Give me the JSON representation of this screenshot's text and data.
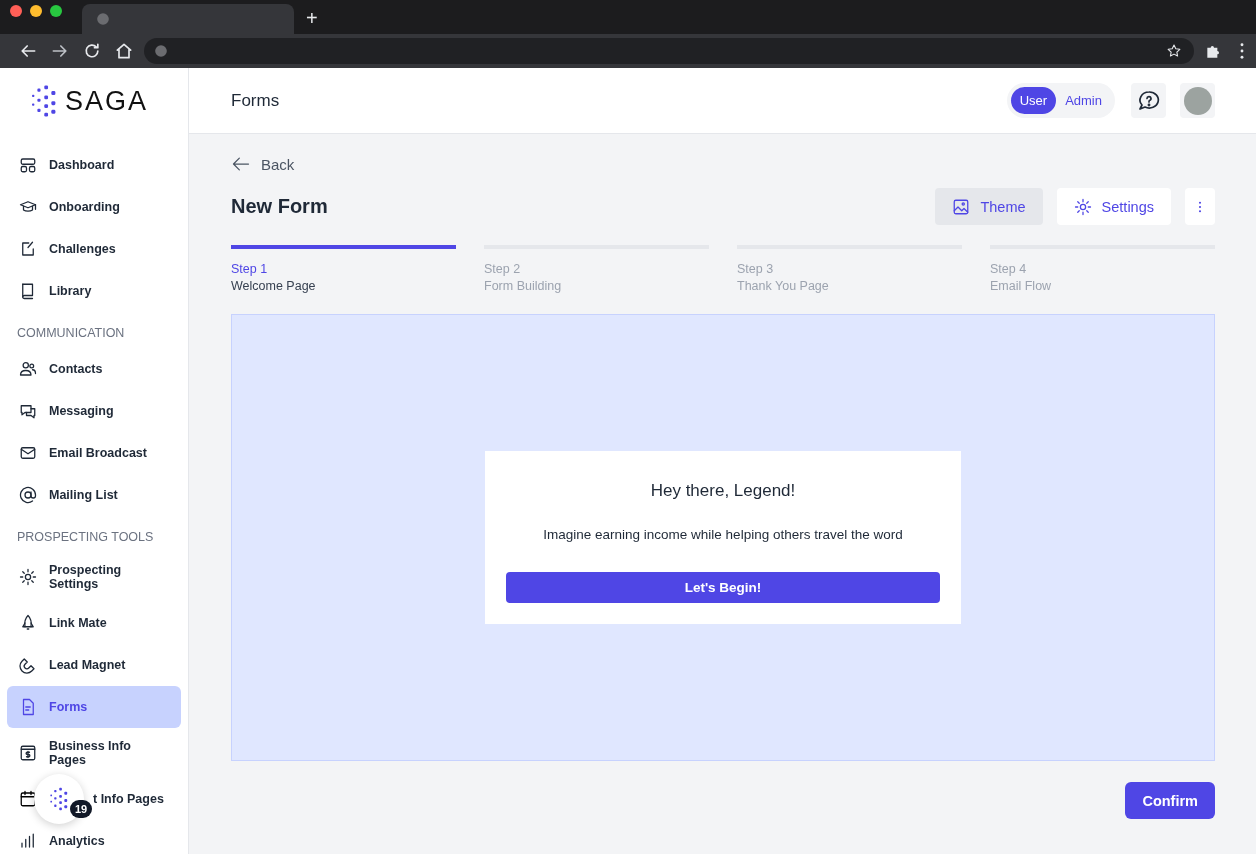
{
  "browser": {
    "new_tab": "+"
  },
  "brand": {
    "name": "SAGA"
  },
  "header": {
    "title": "Forms",
    "role_toggle": [
      {
        "label": "User",
        "selected": true
      },
      {
        "label": "Admin",
        "selected": false
      }
    ]
  },
  "sidebar": {
    "sections": [
      {
        "items": [
          {
            "label": "Dashboard",
            "selected": false,
            "kind": "link"
          },
          {
            "label": "Onboarding",
            "selected": false,
            "kind": "link"
          },
          {
            "label": "Challenges",
            "selected": false,
            "kind": "link"
          },
          {
            "label": "Library",
            "selected": false,
            "kind": "link"
          }
        ]
      },
      {
        "heading": "COMMUNICATION",
        "items": [
          {
            "label": "Contacts",
            "selected": false,
            "kind": "link"
          },
          {
            "label": "Messaging",
            "selected": false,
            "kind": "link"
          },
          {
            "label": "Email Broadcast",
            "selected": false,
            "kind": "link"
          },
          {
            "label": "Mailing List",
            "selected": false,
            "kind": "link"
          }
        ]
      },
      {
        "heading": "PROSPECTING TOOLS",
        "items": [
          {
            "label": "Prospecting Settings",
            "selected": false,
            "kind": "link"
          },
          {
            "label": "Link Mate",
            "selected": false,
            "kind": "link"
          },
          {
            "label": "Lead Magnet",
            "selected": false,
            "kind": "link"
          },
          {
            "label": "Forms",
            "selected": true,
            "kind": "link"
          },
          {
            "label": "Business Info Pages",
            "selected": false,
            "kind": "link"
          },
          {
            "label": "t Info Pages",
            "selected": false,
            "kind": "covered"
          },
          {
            "label": "Analytics",
            "selected": false,
            "kind": "link"
          }
        ]
      }
    ]
  },
  "floating_button": {
    "badge": "19"
  },
  "page": {
    "back": "Back",
    "title": "New Form",
    "actions": [
      {
        "label": "Theme",
        "selected": true
      },
      {
        "label": "Settings",
        "selected": false
      }
    ],
    "steps": [
      {
        "step": "Step 1",
        "name": "Welcome Page",
        "selected": true
      },
      {
        "step": "Step 2",
        "name": "Form Building",
        "selected": false
      },
      {
        "step": "Step 3",
        "name": "Thank You Page",
        "selected": false
      },
      {
        "step": "Step 4",
        "name": "Email Flow",
        "selected": false
      }
    ],
    "preview": {
      "heading": "Hey there, Legend!",
      "text": "Imagine earning income while helping others travel the word",
      "button": "Let's Begin!"
    },
    "confirm": "Confirm"
  }
}
